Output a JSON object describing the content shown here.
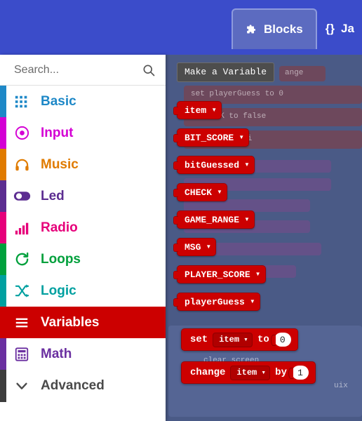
{
  "topbar": {
    "tabs": [
      {
        "label": "Blocks",
        "icon": "puzzle-icon",
        "active": true
      },
      {
        "label": "Ja",
        "icon": "braces-icon",
        "active": false
      }
    ],
    "background_color": "#3B4CCA",
    "active_tab_color": "#5C6BC0"
  },
  "search": {
    "placeholder": "Search...",
    "value": "",
    "icon": "search-icon"
  },
  "toolbox": {
    "categories": [
      {
        "label": "Basic",
        "color": "#1E88C7",
        "icon": "grid-icon",
        "selected": false
      },
      {
        "label": "Input",
        "color": "#D400D4",
        "icon": "target-icon",
        "selected": false
      },
      {
        "label": "Music",
        "color": "#E07B00",
        "icon": "headphones-icon",
        "selected": false
      },
      {
        "label": "Led",
        "color": "#5C2D91",
        "icon": "toggle-icon",
        "selected": false
      },
      {
        "label": "Radio",
        "color": "#E6007A",
        "icon": "signal-icon",
        "selected": false
      },
      {
        "label": "Loops",
        "color": "#00A03C",
        "icon": "refresh-icon",
        "selected": false
      },
      {
        "label": "Logic",
        "color": "#00A0A0",
        "icon": "shuffle-icon",
        "selected": false
      },
      {
        "label": "Variables",
        "color": "#CC0000",
        "icon": "lines-icon",
        "selected": true
      },
      {
        "label": "Math",
        "color": "#6A2FA0",
        "icon": "calculator-icon",
        "selected": false
      }
    ],
    "advanced": {
      "label": "Advanced",
      "icon": "chevron-down-icon",
      "color": "#3d3d3d"
    }
  },
  "flyout": {
    "make_variable_label": "Make a Variable",
    "variables": [
      {
        "name": "item"
      },
      {
        "name": "BIT_SCORE"
      },
      {
        "name": "bitGuessed"
      },
      {
        "name": "CHECK"
      },
      {
        "name": "GAME_RANGE"
      },
      {
        "name": "MSG"
      },
      {
        "name": "PLAYER_SCORE"
      },
      {
        "name": "playerGuess"
      }
    ],
    "statements": [
      {
        "id": "set",
        "kw1": "set",
        "var": "item",
        "kw2": "to",
        "value": "0"
      },
      {
        "id": "change",
        "kw1": "change",
        "var": "item",
        "kw2": "by",
        "value": "1"
      }
    ],
    "block_color": "#CC0000"
  },
  "workspace": {
    "background_color": "#6b7aa8",
    "dim_color": "#4a5a86",
    "ghost_blocks": [
      {
        "text": "ange"
      },
      {
        "text": "set playerGuess   to      0"
      },
      {
        "text": "ECK     to       false"
      },
      {
        "text": "sed    to     pi"
      },
      {
        "text": "clear screen"
      },
      {
        "text": "uix"
      }
    ]
  }
}
